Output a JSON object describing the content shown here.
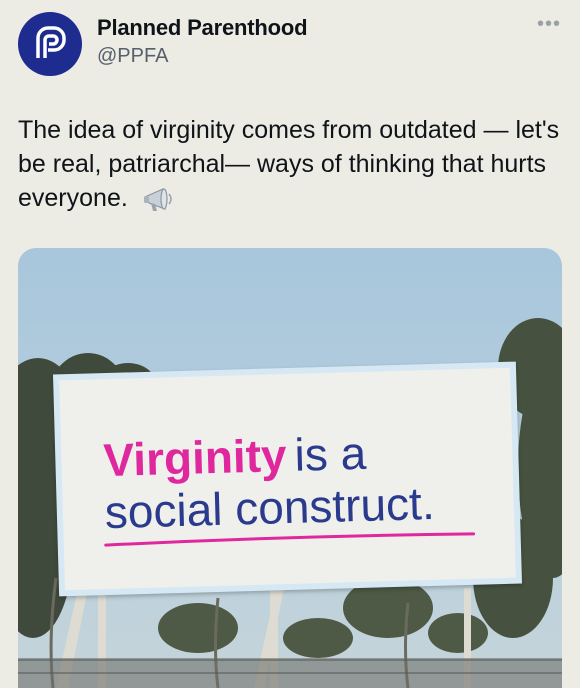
{
  "account": {
    "name": "Planned Parenthood",
    "handle": "@PPFA"
  },
  "tweet": {
    "text": "The idea of virginity comes from outdated — let's be real, patriarchal— ways of thinking that hurts everyone.",
    "emoji_icon": "megaphone-icon"
  },
  "billboard": {
    "word_highlight": "Virginity",
    "line1_rest": "is a",
    "line2": "social construct.",
    "colors": {
      "highlight": "#e0289e",
      "text": "#2a3a8c"
    }
  },
  "icons": {
    "more": "more-options-icon",
    "avatar": "planned-parenthood-logo"
  },
  "colors": {
    "background": "#ecebe4",
    "avatar_bg": "#1e2b8f",
    "handle": "#55606b"
  }
}
